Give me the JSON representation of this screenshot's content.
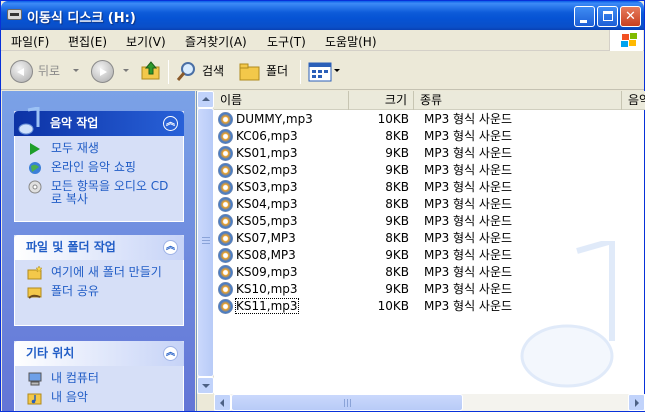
{
  "window": {
    "title": "이동식 디스크 (H:)",
    "colors": {
      "titlebar": "#0a4fc8",
      "tasklink": "#215dc6",
      "pane": "#7ba2e7"
    }
  },
  "title_buttons": {
    "minimize": "minimize",
    "maximize": "maximize",
    "close": "close"
  },
  "menu": [
    "파일(F)",
    "편집(E)",
    "보기(V)",
    "즐겨찾기(A)",
    "도구(T)",
    "도움말(H)"
  ],
  "toolbar": {
    "back_label": "뒤로",
    "search_label": "검색",
    "folders_label": "폴더",
    "icons": [
      "back-icon",
      "forward-icon",
      "up-folder-icon",
      "search-icon",
      "folders-icon",
      "views-icon"
    ]
  },
  "panels": {
    "music": {
      "title": "음악 작업",
      "tasks": [
        "모두 재생",
        "온라인 음악 쇼핑",
        "모든 항목을 오디오 CD로 복사"
      ]
    },
    "file": {
      "title": "파일 및 폴더 작업",
      "tasks": [
        "여기에 새 폴더 만들기",
        "폴더 공유"
      ]
    },
    "other": {
      "title": "기타 위치",
      "tasks": [
        "내 컴퓨터",
        "내 음악"
      ]
    }
  },
  "columns": {
    "name": "이름",
    "size": "크기",
    "type": "종류",
    "extra": "음악"
  },
  "files": [
    {
      "name": "DUMMY,mp3",
      "size": "10KB",
      "type": "MP3 형식 사운드"
    },
    {
      "name": "KC06,mp3",
      "size": "8KB",
      "type": "MP3 형식 사운드"
    },
    {
      "name": "KS01,mp3",
      "size": "9KB",
      "type": "MP3 형식 사운드"
    },
    {
      "name": "KS02,mp3",
      "size": "9KB",
      "type": "MP3 형식 사운드"
    },
    {
      "name": "KS03,mp3",
      "size": "8KB",
      "type": "MP3 형식 사운드"
    },
    {
      "name": "KS04,mp3",
      "size": "8KB",
      "type": "MP3 형식 사운드"
    },
    {
      "name": "KS05,mp3",
      "size": "9KB",
      "type": "MP3 형식 사운드"
    },
    {
      "name": "KS07,MP3",
      "size": "8KB",
      "type": "MP3 형식 사운드"
    },
    {
      "name": "KS08,MP3",
      "size": "9KB",
      "type": "MP3 형식 사운드"
    },
    {
      "name": "KS09,mp3",
      "size": "8KB",
      "type": "MP3 형식 사운드"
    },
    {
      "name": "KS10,mp3",
      "size": "9KB",
      "type": "MP3 형식 사운드"
    },
    {
      "name": "KS11,mp3",
      "size": "10KB",
      "type": "MP3 형식 사운드"
    }
  ]
}
